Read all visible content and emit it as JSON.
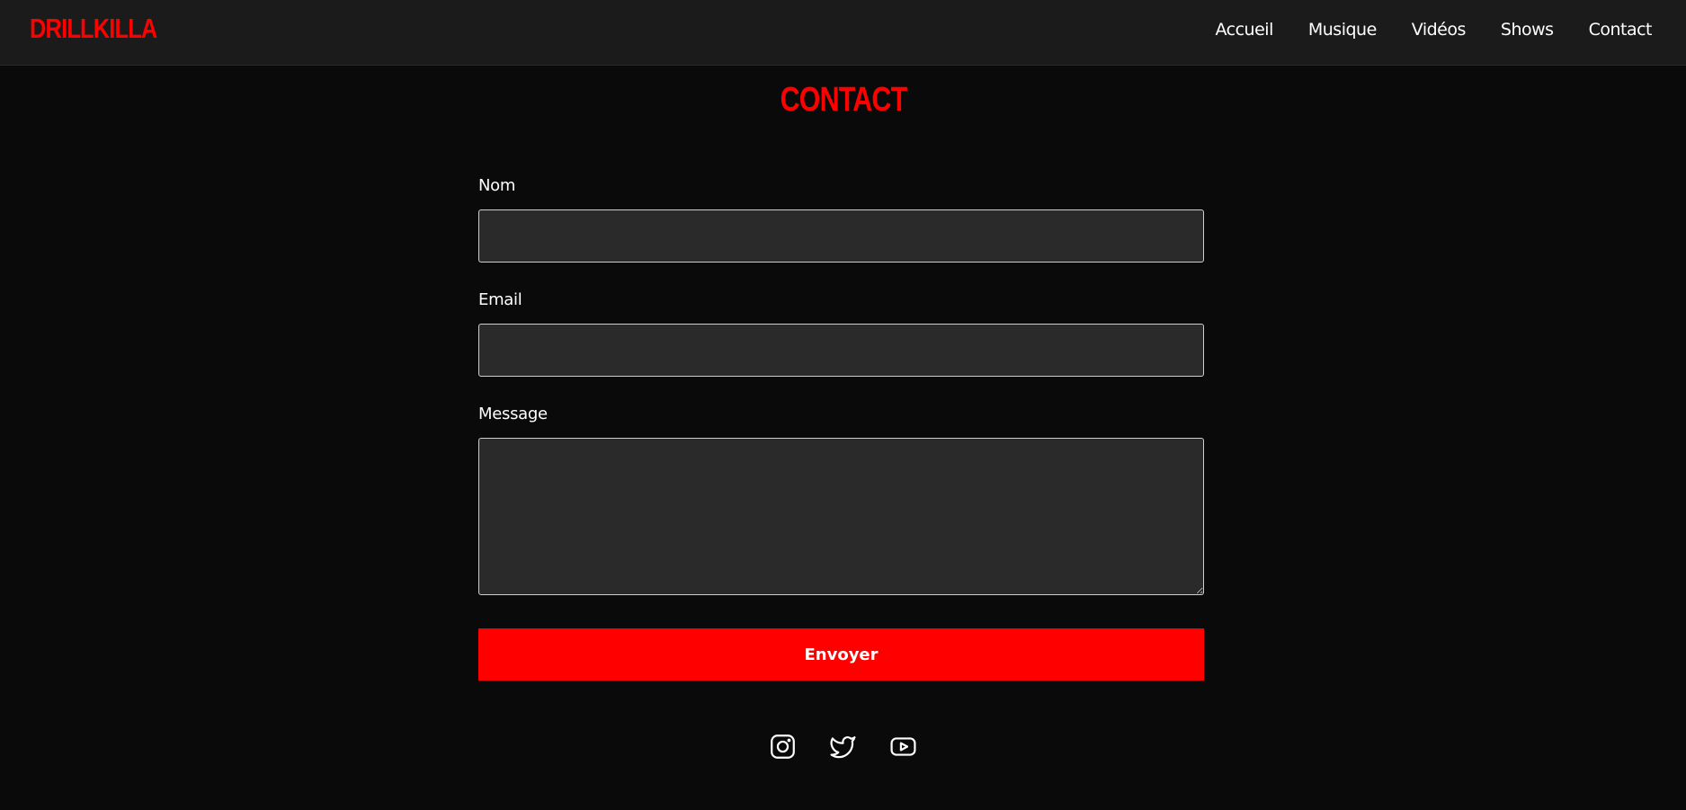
{
  "header": {
    "logo": "DRILLKILLA",
    "nav": [
      {
        "label": "Accueil"
      },
      {
        "label": "Musique"
      },
      {
        "label": "Vidéos"
      },
      {
        "label": "Shows"
      },
      {
        "label": "Contact"
      }
    ]
  },
  "main": {
    "title": "CONTACT",
    "form": {
      "name_label": "Nom",
      "name_value": "",
      "email_label": "Email",
      "email_value": "",
      "message_label": "Message",
      "message_value": "",
      "submit_label": "Envoyer"
    }
  },
  "footer": {
    "socials": [
      {
        "icon": "instagram-icon"
      },
      {
        "icon": "twitter-icon"
      },
      {
        "icon": "youtube-icon"
      }
    ]
  },
  "colors": {
    "accent": "#ff0000",
    "background": "#0a0a0a",
    "header": "#1b1b1b",
    "input": "#2a2a2a"
  }
}
